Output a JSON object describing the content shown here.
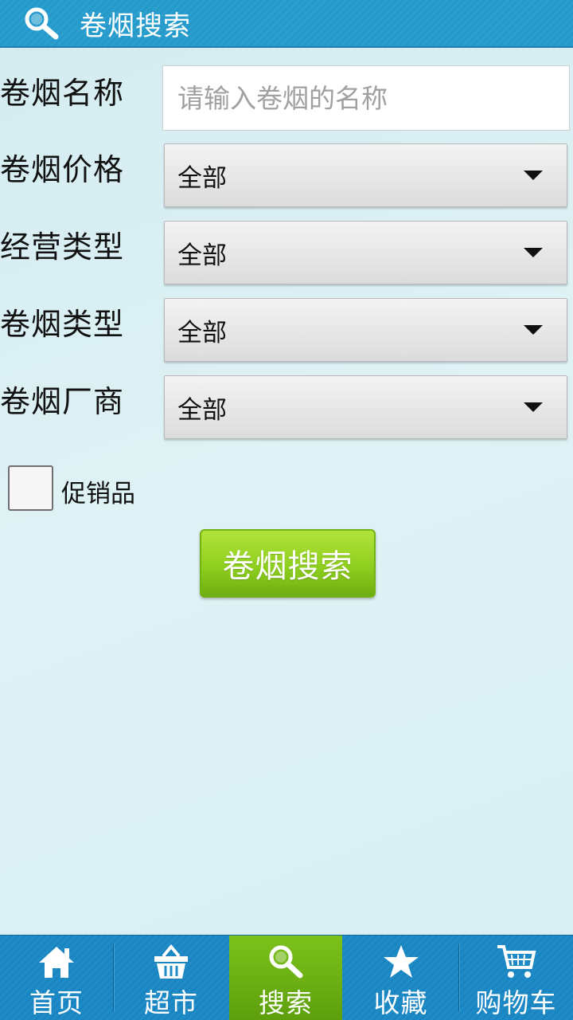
{
  "header": {
    "title": "卷烟搜索",
    "icon": "search-icon"
  },
  "form": {
    "name": {
      "label": "卷烟名称",
      "placeholder": "请输入卷烟的名称",
      "value": ""
    },
    "price": {
      "label": "卷烟价格",
      "value": "全部"
    },
    "business_type": {
      "label": "经营类型",
      "value": "全部"
    },
    "cigarette_type": {
      "label": "卷烟类型",
      "value": "全部"
    },
    "manufacturer": {
      "label": "卷烟厂商",
      "value": "全部"
    },
    "promotion": {
      "label": "促销品",
      "checked": false
    },
    "search_button": "卷烟搜索"
  },
  "tabbar": {
    "active": "search",
    "items": [
      {
        "id": "home",
        "label": "首页",
        "icon": "home-icon"
      },
      {
        "id": "market",
        "label": "超市",
        "icon": "basket-icon"
      },
      {
        "id": "search",
        "label": "搜索",
        "icon": "search-icon"
      },
      {
        "id": "favorites",
        "label": "收藏",
        "icon": "star-icon"
      },
      {
        "id": "cart",
        "label": "购物车",
        "icon": "cart-icon"
      }
    ]
  },
  "colors": {
    "header": "#2a9fd0",
    "tabbar": "#1f8cc8",
    "active_tab": "#7cc21a",
    "search_button": "#8fcf1f"
  }
}
